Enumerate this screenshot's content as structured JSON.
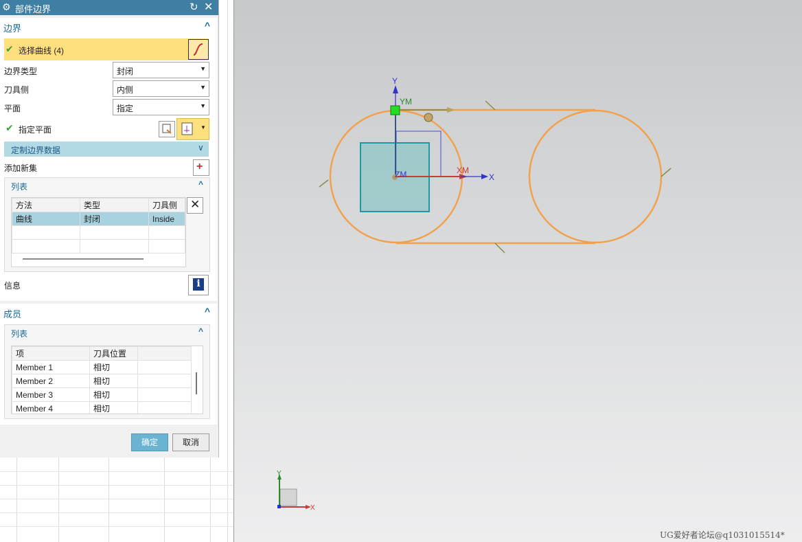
{
  "dialog": {
    "title": "部件边界",
    "boundary_section": {
      "title": "边界",
      "select_curve_label": "选择曲线 (4)",
      "boundary_type_label": "边界类型",
      "boundary_type_value": "封闭",
      "tool_side_label": "刀具侧",
      "tool_side_value": "内侧",
      "plane_label": "平面",
      "plane_value": "指定",
      "specify_plane_label": "指定平面",
      "custom_data_label": "定制边界数据",
      "add_new_set_label": "添加新集",
      "list_title": "列表",
      "list_headers": [
        "方法",
        "类型",
        "刀具侧"
      ],
      "list_rows": [
        [
          "曲线",
          "封闭",
          "Inside"
        ]
      ],
      "info_label": "信息"
    },
    "members_section": {
      "title": "成员",
      "list_title": "列表",
      "headers": [
        "项",
        "刀具位置"
      ],
      "rows": [
        [
          "Member 1",
          "相切"
        ],
        [
          "Member 2",
          "相切"
        ],
        [
          "Member 3",
          "相切"
        ],
        [
          "Member 4",
          "相切"
        ]
      ]
    },
    "ok_label": "确定",
    "cancel_label": "取消"
  },
  "viewport": {
    "axis_labels": {
      "y": "Y",
      "ym": "YM",
      "xm": "XM",
      "x": "X",
      "zm": "ZM"
    },
    "triad_labels": {
      "y": "Y",
      "x": "X"
    },
    "watermark": "UG爱好者论坛@q1031015514*"
  },
  "colors": {
    "title_bar": "#3f7fa3",
    "accent_blue": "#1f6b99",
    "selected_row": "#a9d2e1",
    "highlight_yellow": "#ffdf7e",
    "curve_orange": "#f2a04a",
    "ok_button": "#6ab4d1"
  }
}
